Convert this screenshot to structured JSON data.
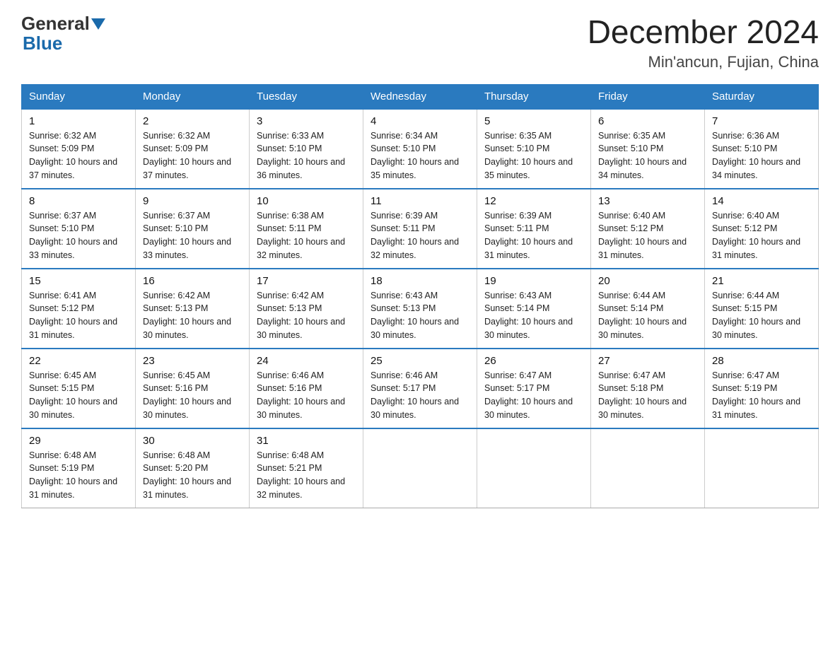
{
  "logo": {
    "general": "General",
    "blue": "Blue"
  },
  "header": {
    "month": "December 2024",
    "location": "Min'ancun, Fujian, China"
  },
  "days_of_week": [
    "Sunday",
    "Monday",
    "Tuesday",
    "Wednesday",
    "Thursday",
    "Friday",
    "Saturday"
  ],
  "weeks": [
    [
      {
        "day": "1",
        "sunrise": "6:32 AM",
        "sunset": "5:09 PM",
        "daylight": "10 hours and 37 minutes."
      },
      {
        "day": "2",
        "sunrise": "6:32 AM",
        "sunset": "5:09 PM",
        "daylight": "10 hours and 37 minutes."
      },
      {
        "day": "3",
        "sunrise": "6:33 AM",
        "sunset": "5:10 PM",
        "daylight": "10 hours and 36 minutes."
      },
      {
        "day": "4",
        "sunrise": "6:34 AM",
        "sunset": "5:10 PM",
        "daylight": "10 hours and 35 minutes."
      },
      {
        "day": "5",
        "sunrise": "6:35 AM",
        "sunset": "5:10 PM",
        "daylight": "10 hours and 35 minutes."
      },
      {
        "day": "6",
        "sunrise": "6:35 AM",
        "sunset": "5:10 PM",
        "daylight": "10 hours and 34 minutes."
      },
      {
        "day": "7",
        "sunrise": "6:36 AM",
        "sunset": "5:10 PM",
        "daylight": "10 hours and 34 minutes."
      }
    ],
    [
      {
        "day": "8",
        "sunrise": "6:37 AM",
        "sunset": "5:10 PM",
        "daylight": "10 hours and 33 minutes."
      },
      {
        "day": "9",
        "sunrise": "6:37 AM",
        "sunset": "5:10 PM",
        "daylight": "10 hours and 33 minutes."
      },
      {
        "day": "10",
        "sunrise": "6:38 AM",
        "sunset": "5:11 PM",
        "daylight": "10 hours and 32 minutes."
      },
      {
        "day": "11",
        "sunrise": "6:39 AM",
        "sunset": "5:11 PM",
        "daylight": "10 hours and 32 minutes."
      },
      {
        "day": "12",
        "sunrise": "6:39 AM",
        "sunset": "5:11 PM",
        "daylight": "10 hours and 31 minutes."
      },
      {
        "day": "13",
        "sunrise": "6:40 AM",
        "sunset": "5:12 PM",
        "daylight": "10 hours and 31 minutes."
      },
      {
        "day": "14",
        "sunrise": "6:40 AM",
        "sunset": "5:12 PM",
        "daylight": "10 hours and 31 minutes."
      }
    ],
    [
      {
        "day": "15",
        "sunrise": "6:41 AM",
        "sunset": "5:12 PM",
        "daylight": "10 hours and 31 minutes."
      },
      {
        "day": "16",
        "sunrise": "6:42 AM",
        "sunset": "5:13 PM",
        "daylight": "10 hours and 30 minutes."
      },
      {
        "day": "17",
        "sunrise": "6:42 AM",
        "sunset": "5:13 PM",
        "daylight": "10 hours and 30 minutes."
      },
      {
        "day": "18",
        "sunrise": "6:43 AM",
        "sunset": "5:13 PM",
        "daylight": "10 hours and 30 minutes."
      },
      {
        "day": "19",
        "sunrise": "6:43 AM",
        "sunset": "5:14 PM",
        "daylight": "10 hours and 30 minutes."
      },
      {
        "day": "20",
        "sunrise": "6:44 AM",
        "sunset": "5:14 PM",
        "daylight": "10 hours and 30 minutes."
      },
      {
        "day": "21",
        "sunrise": "6:44 AM",
        "sunset": "5:15 PM",
        "daylight": "10 hours and 30 minutes."
      }
    ],
    [
      {
        "day": "22",
        "sunrise": "6:45 AM",
        "sunset": "5:15 PM",
        "daylight": "10 hours and 30 minutes."
      },
      {
        "day": "23",
        "sunrise": "6:45 AM",
        "sunset": "5:16 PM",
        "daylight": "10 hours and 30 minutes."
      },
      {
        "day": "24",
        "sunrise": "6:46 AM",
        "sunset": "5:16 PM",
        "daylight": "10 hours and 30 minutes."
      },
      {
        "day": "25",
        "sunrise": "6:46 AM",
        "sunset": "5:17 PM",
        "daylight": "10 hours and 30 minutes."
      },
      {
        "day": "26",
        "sunrise": "6:47 AM",
        "sunset": "5:17 PM",
        "daylight": "10 hours and 30 minutes."
      },
      {
        "day": "27",
        "sunrise": "6:47 AM",
        "sunset": "5:18 PM",
        "daylight": "10 hours and 30 minutes."
      },
      {
        "day": "28",
        "sunrise": "6:47 AM",
        "sunset": "5:19 PM",
        "daylight": "10 hours and 31 minutes."
      }
    ],
    [
      {
        "day": "29",
        "sunrise": "6:48 AM",
        "sunset": "5:19 PM",
        "daylight": "10 hours and 31 minutes."
      },
      {
        "day": "30",
        "sunrise": "6:48 AM",
        "sunset": "5:20 PM",
        "daylight": "10 hours and 31 minutes."
      },
      {
        "day": "31",
        "sunrise": "6:48 AM",
        "sunset": "5:21 PM",
        "daylight": "10 hours and 32 minutes."
      },
      null,
      null,
      null,
      null
    ]
  ]
}
